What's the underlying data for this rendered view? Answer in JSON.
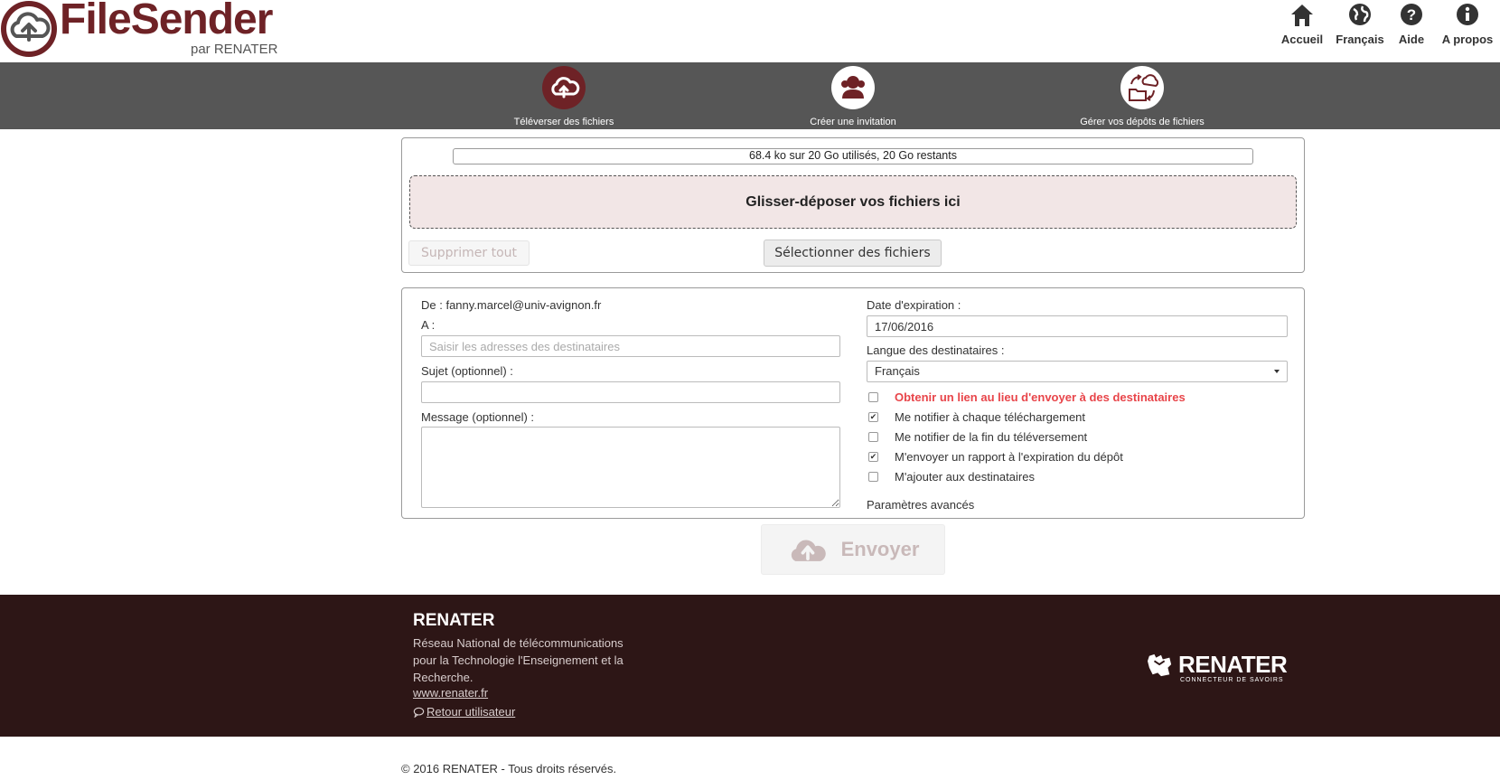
{
  "header": {
    "logo_title": "FileSender",
    "logo_subtitle": "par RENATER",
    "nav": [
      {
        "label": "Accueil",
        "icon": "home-icon"
      },
      {
        "label": "Français",
        "icon": "globe-icon"
      },
      {
        "label": "Aide",
        "icon": "help-icon"
      },
      {
        "label": "A propos",
        "icon": "info-icon"
      }
    ]
  },
  "main_nav": [
    {
      "label": "Téléverser des fichiers",
      "icon": "cloud-upload-icon",
      "active": true
    },
    {
      "label": "Créer une invitation",
      "icon": "users-icon",
      "active": false
    },
    {
      "label": "Gérer vos dépôts de fichiers",
      "icon": "folder-sync-icon",
      "active": false
    }
  ],
  "upload": {
    "quota_text": "68.4 ko sur 20 Go utilisés, 20 Go restants",
    "drop_text": "Glisser-déposer vos fichiers ici",
    "clear_all_label": "Supprimer tout",
    "select_files_label": "Sélectionner des fichiers"
  },
  "form": {
    "from_label": "De : fanny.marcel@univ-avignon.fr",
    "to_label": "A :",
    "to_placeholder": "Saisir les adresses des destinataires",
    "subject_label": "Sujet (optionnel) :",
    "subject_value": "",
    "message_label": "Message (optionnel) :",
    "message_value": "",
    "expiry_label": "Date d'expiration :",
    "expiry_value": "17/06/2016",
    "lang_label": "Langue des destinataires :",
    "lang_value": "Français",
    "options": [
      {
        "label": "Obtenir un lien au lieu d'envoyer à des destinataires",
        "checked": false,
        "highlight": true
      },
      {
        "label": "Me notifier à chaque téléchargement",
        "checked": true,
        "highlight": false
      },
      {
        "label": "Me notifier de la fin du téléversement",
        "checked": false,
        "highlight": false
      },
      {
        "label": "M'envoyer un rapport à l'expiration du dépôt",
        "checked": true,
        "highlight": false
      },
      {
        "label": "M'ajouter aux destinataires",
        "checked": false,
        "highlight": false
      }
    ],
    "advanced_label": "Paramètres avancés"
  },
  "send_label": "Envoyer",
  "footer": {
    "title": "RENATER",
    "description": "Réseau National de télécommunications pour la Technologie l'Enseignement et la Recherche.",
    "link": "www.renater.fr",
    "back": "Retour utilisateur",
    "logo_text": "RENATER",
    "logo_sub": "CONNECTEUR DE SAVOIRS"
  },
  "copyright": "© 2016 RENATER - Tous droits réservés.",
  "colors": {
    "brand": "#6e2226",
    "nav_bg": "#565656",
    "footer_bg": "#2d1616",
    "drop_bg": "#f2e6e6",
    "alert": "#e8454a"
  }
}
